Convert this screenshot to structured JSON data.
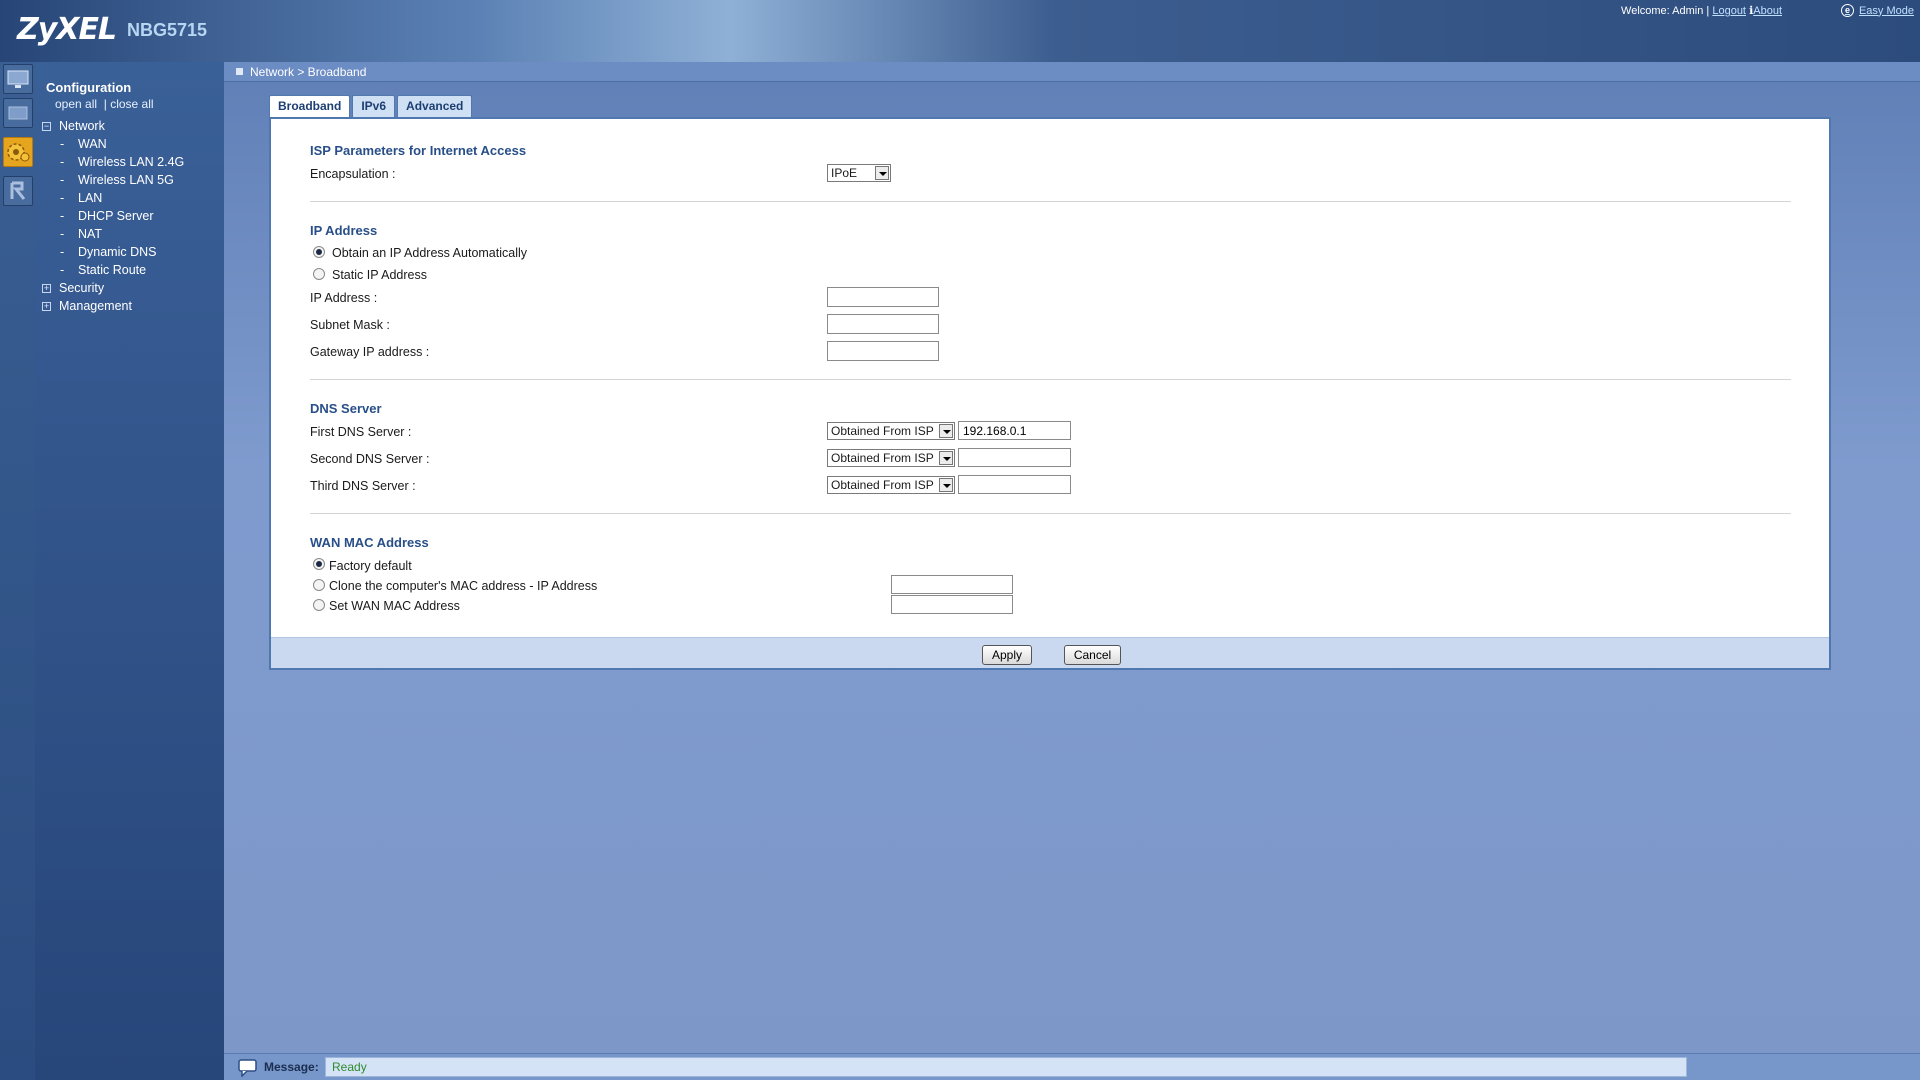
{
  "header": {
    "logo": "ZyXEL",
    "model": "NBG5715",
    "welcome": "Welcome: Admin |",
    "logout": "Logout",
    "about": "About",
    "easy_mode": "Easy Mode"
  },
  "sidebar": {
    "title": "Configuration",
    "open_all": "open all",
    "separator": "|",
    "close_all": "close all",
    "network": "Network",
    "network_items": [
      "WAN",
      "Wireless LAN 2.4G",
      "Wireless LAN 5G",
      "LAN",
      "DHCP Server",
      "NAT",
      "Dynamic DNS",
      "Static Route"
    ],
    "security": "Security",
    "management": "Management"
  },
  "breadcrumb": "Network > Broadband",
  "tabs": [
    "Broadband",
    "IPv6",
    "Advanced"
  ],
  "form": {
    "isp_title": "ISP Parameters for Internet Access",
    "encapsulation_label": "Encapsulation :",
    "encapsulation_value": "IPoE",
    "ip_title": "IP Address",
    "obtain_auto": "Obtain an IP Address Automatically",
    "static_ip": "Static IP Address",
    "ip_address_label": "IP Address :",
    "subnet_mask_label": "Subnet Mask :",
    "gateway_label": "Gateway IP address :",
    "dns_title": "DNS Server",
    "first_dns_label": "First DNS Server :",
    "second_dns_label": "Second DNS Server :",
    "third_dns_label": "Third DNS Server :",
    "dns_mode": "Obtained From ISP",
    "first_dns_value": "192.168.0.1",
    "mac_title": "WAN MAC Address",
    "factory_default": "Factory default",
    "clone_mac": "Clone the computer's MAC address - IP Address",
    "set_mac": "Set WAN MAC Address",
    "apply": "Apply",
    "cancel": "Cancel"
  },
  "status": {
    "label": "Message:",
    "value": "Ready"
  }
}
